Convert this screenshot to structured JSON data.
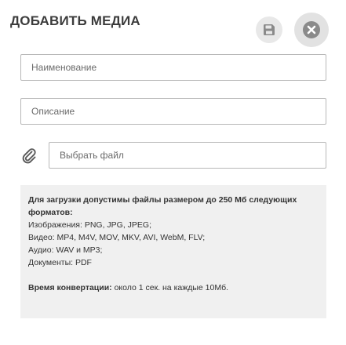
{
  "header": {
    "title": "ДОБАВИТЬ МЕДИА",
    "save_icon": "floppy-disk-icon",
    "close_icon": "close-icon"
  },
  "form": {
    "name_placeholder": "Наименование",
    "description_placeholder": "Описание",
    "file_label": "Выбрать файл",
    "attach_icon": "paperclip-icon"
  },
  "info": {
    "intro": "Для загрузки допустимы файлы размером до 250 Мб следующих форматов:",
    "formats": [
      "Изображения: PNG, JPG, JPEG;",
      "Видео: MP4, M4V, MOV, MKV, AVI, WebM, FLV;",
      "Аудио: WAV и MP3;",
      "Документы: PDF"
    ],
    "conversion_label": "Время конвертации:",
    "conversion_text": " около 1 сек. на каждые 10Мб."
  },
  "colors": {
    "button_bg": "#e2e2e2",
    "info_bg": "#f0f0f0",
    "icon": "#8a8a8a"
  }
}
